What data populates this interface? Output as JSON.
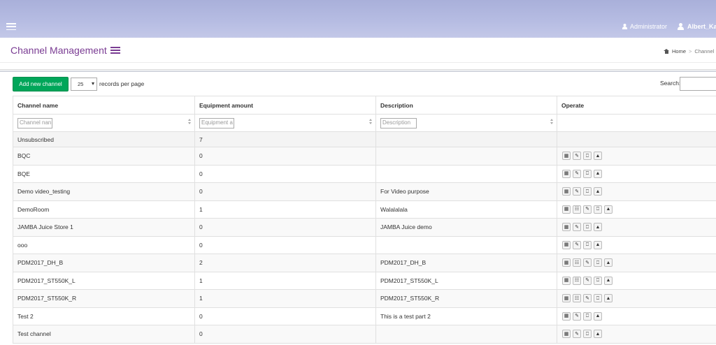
{
  "topbar": {
    "admin_label": "Administrator",
    "user_label": "Albert_Kan"
  },
  "header": {
    "title": "Channel Management",
    "breadcrumb_home": "Home",
    "breadcrumb_sep": ">",
    "breadcrumb_current": "Channel M"
  },
  "toolbar": {
    "add_label": "Add new channel",
    "page_size": "25",
    "records_label": "records per page",
    "search_label": "Search:"
  },
  "table": {
    "headers": {
      "name": "Channel name",
      "amount": "Equipment amount",
      "description": "Description",
      "operate": "Operate"
    },
    "filters": {
      "name": "Channel nan",
      "amount": "Equipment a",
      "description": "Description"
    },
    "rows": [
      {
        "name": "Unsubscribed",
        "amount": "7",
        "description": ""
      },
      {
        "name": "BQC",
        "amount": "0",
        "description": ""
      },
      {
        "name": "BQE",
        "amount": "0",
        "description": ""
      },
      {
        "name": "Demo video_testing",
        "amount": "0",
        "description": "For Video purpose"
      },
      {
        "name": "DemoRoom",
        "amount": "1",
        "description": "Walalalala"
      },
      {
        "name": "JAMBA Juice Store 1",
        "amount": "0",
        "description": "JAMBA Juice demo"
      },
      {
        "name": "ooo",
        "amount": "0",
        "description": ""
      },
      {
        "name": "PDM2017_DH_B",
        "amount": "2",
        "description": "PDM2017_DH_B"
      },
      {
        "name": "PDM2017_ST550K_L",
        "amount": "1",
        "description": "PDM2017_ST550K_L"
      },
      {
        "name": "PDM2017_ST550K_R",
        "amount": "1",
        "description": "PDM2017_ST550K_R"
      },
      {
        "name": "Test 2",
        "amount": "0",
        "description": "This is a test part 2"
      },
      {
        "name": "Test channel",
        "amount": "0",
        "description": ""
      }
    ]
  },
  "colors": {
    "topbar": "#b7bde3",
    "title": "#7a3c93",
    "add_button": "#00a65a"
  }
}
